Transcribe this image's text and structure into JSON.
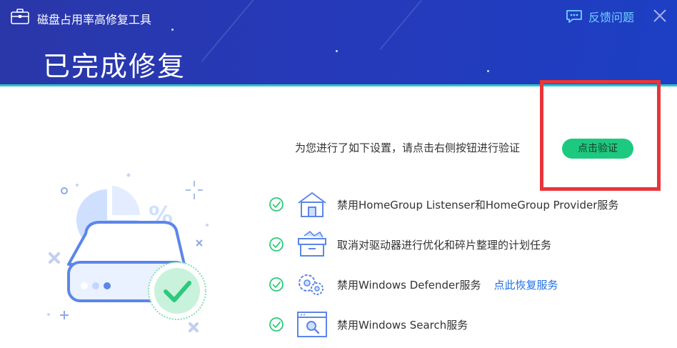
{
  "window": {
    "app_title": "磁盘占用率高修复工具",
    "feedback_label": "反馈问题"
  },
  "header": {
    "page_title": "已完成修复"
  },
  "main": {
    "intro_text": "为您进行了如下设置，请点击右侧按钮进行验证",
    "verify_button_label": "点击验证",
    "items": [
      {
        "icon": "house-icon",
        "label": "禁用HomeGroup Listenser和HomeGroup Provider服务",
        "status": "done"
      },
      {
        "icon": "drive-box-icon",
        "label": "取消对驱动器进行优化和碎片整理的计划任务",
        "status": "done"
      },
      {
        "icon": "gear-cluster-icon",
        "label": "禁用Windows Defender服务",
        "status": "done",
        "link": "点此恢复服务"
      },
      {
        "icon": "search-window-icon",
        "label": "禁用Windows Search服务",
        "status": "done"
      }
    ]
  },
  "colors": {
    "header": "#2639b8",
    "accent_teal": "#2ec7c0",
    "success_green": "#1cc97e",
    "link_blue": "#1f6fe6",
    "highlight_red": "#e8353a"
  }
}
